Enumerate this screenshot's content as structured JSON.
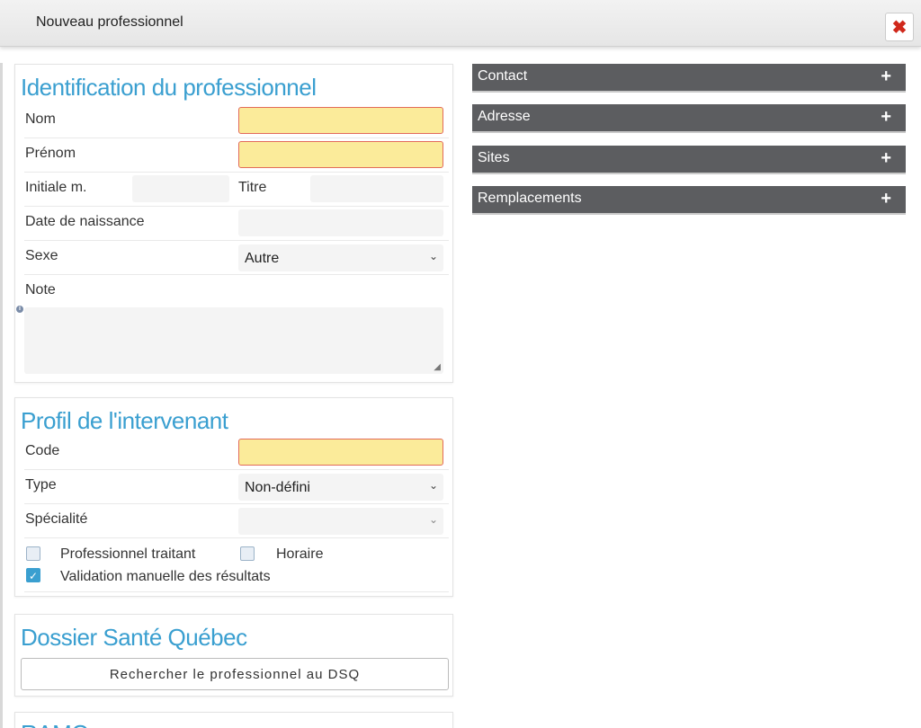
{
  "window": {
    "title": "Nouveau professionnel",
    "close_glyph": "✖"
  },
  "identification": {
    "title": "Identification du professionnel",
    "nom_label": "Nom",
    "prenom_label": "Prénom",
    "initiale_label": "Initiale m.",
    "titre_label": "Titre",
    "naissance_label": "Date de naissance",
    "sexe_label": "Sexe",
    "sexe_value": "Autre",
    "note_label": "Note"
  },
  "profil": {
    "title": "Profil de l'intervenant",
    "code_label": "Code",
    "type_label": "Type",
    "type_value": "Non-défini",
    "specialite_label": "Spécialité",
    "specialite_value": "",
    "traitant_label": "Professionnel traitant",
    "traitant_checked": false,
    "horaire_label": "Horaire",
    "horaire_checked": false,
    "validation_label": "Validation manuelle des résultats",
    "validation_checked": true
  },
  "dsq": {
    "title": "Dossier Santé Québec",
    "search_button": "Rechercher le professionnel au DSQ"
  },
  "ramq": {
    "title": "RAMQ"
  },
  "accordions": [
    {
      "label": "Contact"
    },
    {
      "label": "Adresse"
    },
    {
      "label": "Sites"
    },
    {
      "label": "Remplacements"
    }
  ],
  "colors": {
    "accent": "#3a9fd0",
    "required_bg": "#fbeb9a",
    "required_border": "#e26b5a",
    "accordion_bg": "#5c5d60",
    "close_red": "#d0281b"
  }
}
